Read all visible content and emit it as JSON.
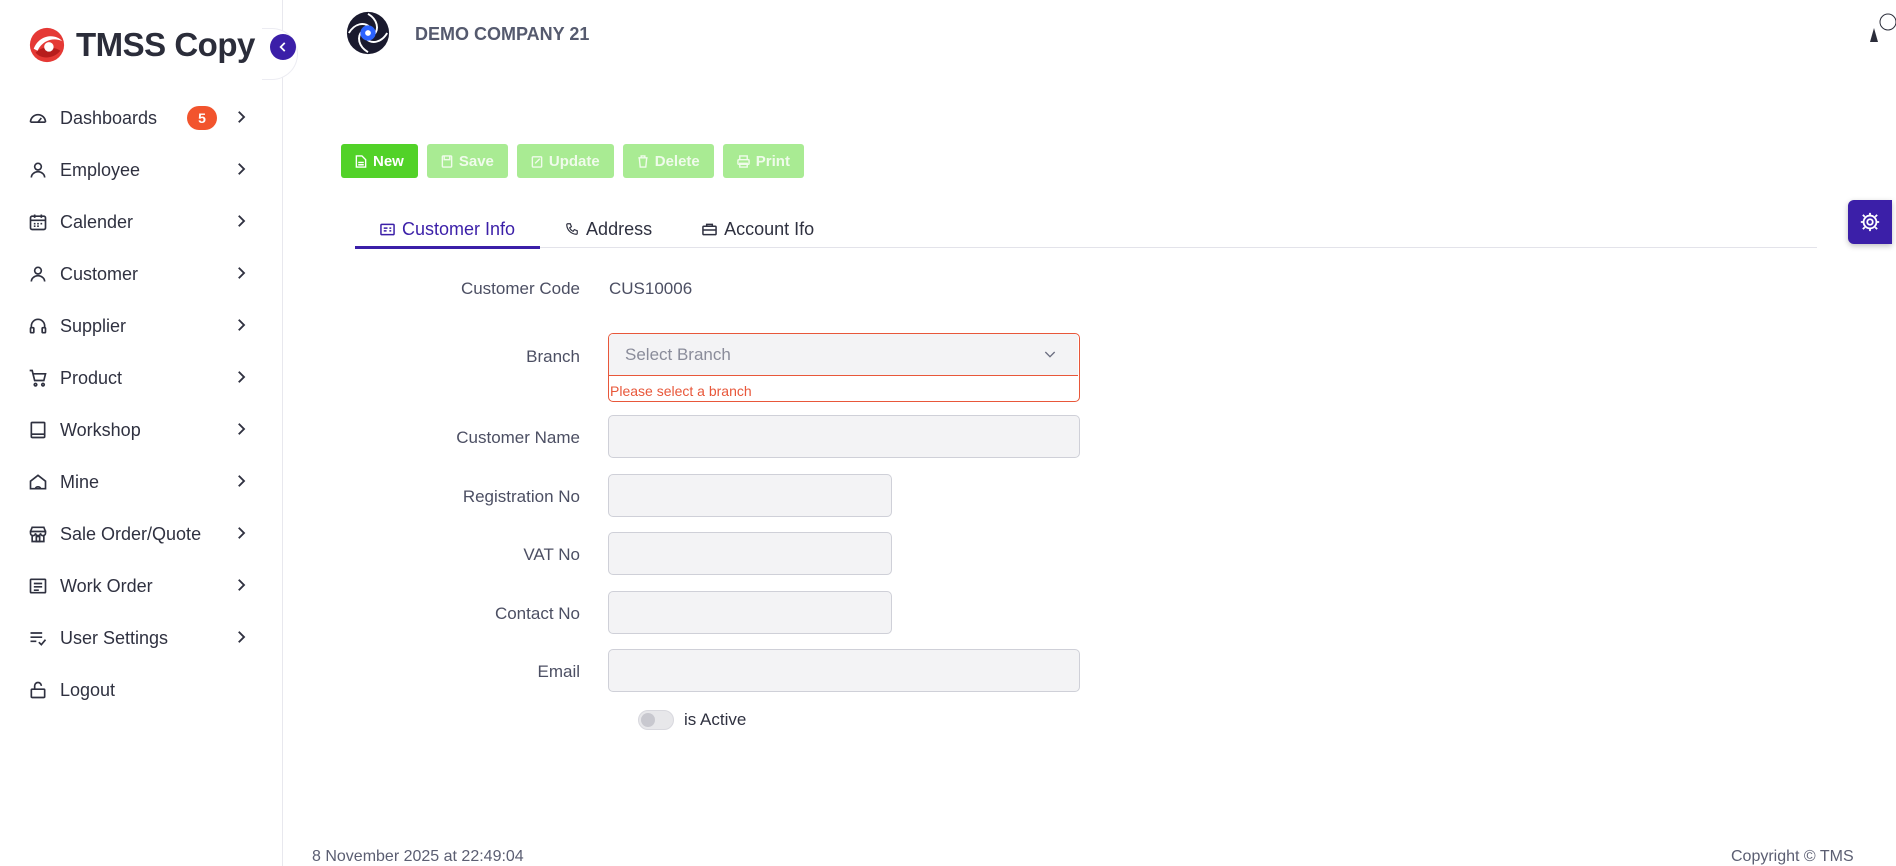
{
  "brand": {
    "name": "TMSS Copy"
  },
  "sidebar": {
    "items": [
      {
        "label": "Dashboards",
        "icon": "gauge-icon",
        "badge": "5"
      },
      {
        "label": "Employee",
        "icon": "user-icon"
      },
      {
        "label": "Calender",
        "icon": "calendar-icon"
      },
      {
        "label": "Customer",
        "icon": "user-icon"
      },
      {
        "label": "Supplier",
        "icon": "headset-icon"
      },
      {
        "label": "Product",
        "icon": "cart-icon"
      },
      {
        "label": "Workshop",
        "icon": "book-icon"
      },
      {
        "label": "Mine",
        "icon": "home-icon"
      },
      {
        "label": "Sale Order/Quote",
        "icon": "store-icon"
      },
      {
        "label": "Work Order",
        "icon": "document-icon"
      },
      {
        "label": "User Settings",
        "icon": "list-check-icon"
      },
      {
        "label": "Logout",
        "icon": "unlock-icon"
      }
    ]
  },
  "header": {
    "company": "DEMO COMPANY 21"
  },
  "toolbar": {
    "new": "New",
    "save": "Save",
    "update": "Update",
    "delete": "Delete",
    "print": "Print"
  },
  "tabs": [
    {
      "label": "Customer Info",
      "active": true
    },
    {
      "label": "Address",
      "active": false
    },
    {
      "label": "Account Ifo",
      "active": false
    }
  ],
  "form": {
    "customer_code_label": "Customer Code",
    "customer_code_value": "CUS10006",
    "branch_label": "Branch",
    "branch_placeholder": "Select Branch",
    "branch_error": "Please select a branch",
    "customer_name_label": "Customer Name",
    "customer_name_value": "",
    "registration_label": "Registration No",
    "registration_value": "",
    "vat_label": "VAT No",
    "vat_value": "",
    "contact_label": "Contact No",
    "contact_value": "",
    "email_label": "Email",
    "email_value": "",
    "active_label": "is Active",
    "active": false
  },
  "footer": {
    "datetime": "8 November 2025 at 22:49:04",
    "copyright": "Copyright © TMS"
  },
  "colors": {
    "accent": "#3b1fa8",
    "new_button": "#52d228",
    "disabled_button": "#a9eb93",
    "error": "#e8573a",
    "badge": "#f2542d"
  }
}
